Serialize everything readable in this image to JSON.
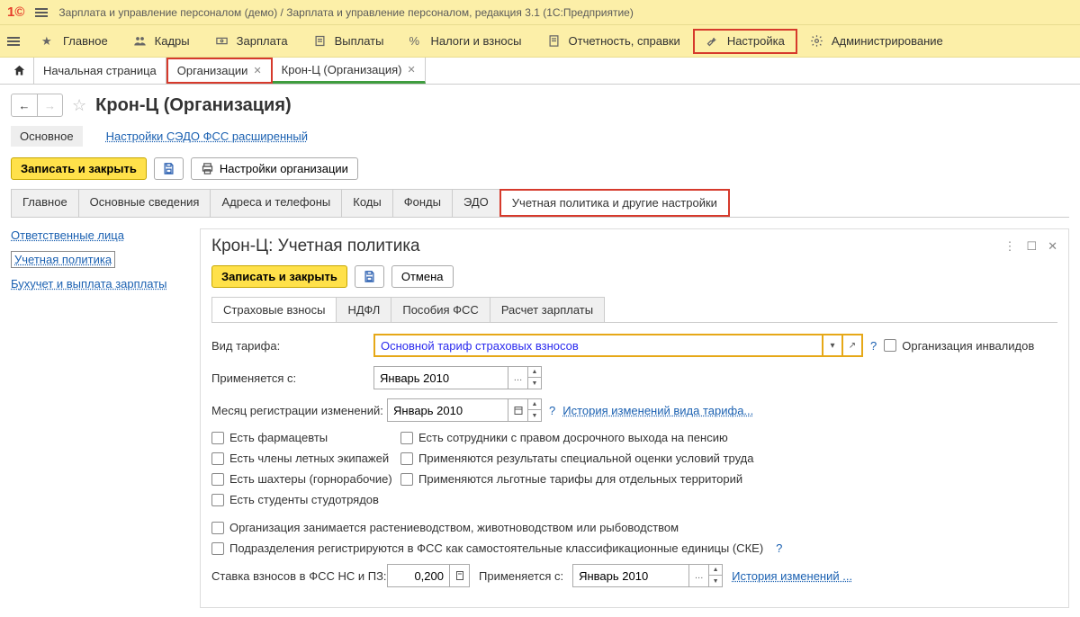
{
  "app": {
    "title": "Зарплата и управление персоналом (демо) / Зарплата и управление персоналом, редакция 3.1  (1С:Предприятие)"
  },
  "main_menu": {
    "items": [
      {
        "name": "main",
        "label": "Главное"
      },
      {
        "name": "kadry",
        "label": "Кадры"
      },
      {
        "name": "zarplata",
        "label": "Зарплата"
      },
      {
        "name": "vyplaty",
        "label": "Выплаты"
      },
      {
        "name": "nalogi",
        "label": "Налоги и взносы"
      },
      {
        "name": "otchetnost",
        "label": "Отчетность, справки"
      },
      {
        "name": "nastroika",
        "label": "Настройка"
      },
      {
        "name": "admin",
        "label": "Администрирование"
      }
    ]
  },
  "page_tabs": {
    "home": "Начальная страница",
    "org": "Организации",
    "kron": "Крон-Ц (Организация)"
  },
  "page": {
    "title": "Крон-Ц (Организация)",
    "section_main": "Основное",
    "section_link": "Настройки СЭДО ФСС расширенный",
    "toolbar": {
      "save_close": "Записать и закрыть",
      "org_settings": "Настройки организации"
    },
    "tabs": [
      "Главное",
      "Основные сведения",
      "Адреса и телефоны",
      "Коды",
      "Фонды",
      "ЭДО",
      "Учетная политика и другие настройки"
    ]
  },
  "sidebar": {
    "links": [
      "Ответственные лица",
      "Учетная политика",
      "Бухучет и выплата зарплаты"
    ]
  },
  "panel": {
    "title": "Крон-Ц: Учетная политика",
    "save_close": "Записать и закрыть",
    "cancel": "Отмена",
    "tabs": [
      "Страховые взносы",
      "НДФЛ",
      "Пособия ФСС",
      "Расчет зарплаты"
    ]
  },
  "form": {
    "labels": {
      "tariff": "Вид тарифа:",
      "apply_from": "Применяется с:",
      "reg_month": "Месяц регистрации изменений:",
      "rate": "Ставка взносов в ФСС НС и ПЗ:"
    },
    "values": {
      "tariff": "Основной тариф страховых взносов",
      "apply_from": "Январь 2010",
      "reg_month": "Январь 2010",
      "rate": "0,200",
      "rate_apply_label": "Применяется с:",
      "rate_apply_from": "Январь 2010"
    },
    "links": {
      "history_tariff": "История изменений вида тарифа...",
      "history_changes": "История изменений ..."
    },
    "checks": {
      "org_invalid": "Организация инвалидов",
      "pharm": "Есть фармацевты",
      "employees_pension": "Есть сотрудники с правом досрочного выхода на пенсию",
      "flight": "Есть члены летных экипажей",
      "spec_eval": "Применяются результаты специальной оценки условий труда",
      "miners": "Есть шахтеры (горнорабочие)",
      "lgot_tariff": "Применяются льготные тарифы для отдельных территорий",
      "students": "Есть студенты студотрядов",
      "agriculture": "Организация занимается растениеводством, животноводством или рыбоводством",
      "subdiv_fss": "Подразделения регистрируются в ФСС как самостоятельные классификационные единицы (СКЕ)"
    }
  }
}
